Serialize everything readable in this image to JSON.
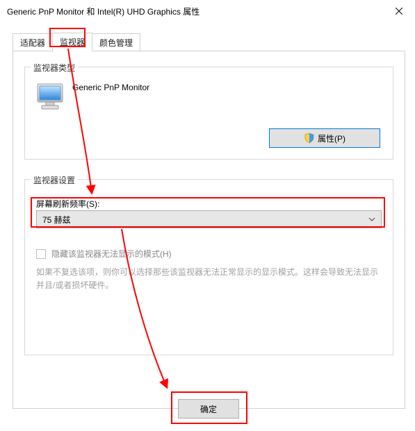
{
  "window": {
    "title": "Generic PnP Monitor 和 Intel(R) UHD Graphics 属性",
    "close_label": "关闭"
  },
  "tabs": {
    "adapter": "适配器",
    "monitor": "监视器",
    "color": "颜色管理"
  },
  "monitor_group": {
    "title": "监视器类型",
    "device_name": "Generic PnP Monitor",
    "properties_button": "属性(P)"
  },
  "settings_group": {
    "title": "监视器设置",
    "refresh_label": "屏幕刷新频率(S):",
    "refresh_value": "75 赫兹",
    "hide_modes_label": "隐藏该监视器无法显示的模式(H)",
    "hide_modes_checked": false,
    "hide_modes_desc": "如果不复选该项，则你可以选择那些该监视器无法正常显示的显示模式。这样会导致无法显示并且/或者损坏硬件。"
  },
  "buttons": {
    "ok": "确定"
  },
  "colors": {
    "accent": "#0078d7",
    "highlight": "#ff0000"
  }
}
